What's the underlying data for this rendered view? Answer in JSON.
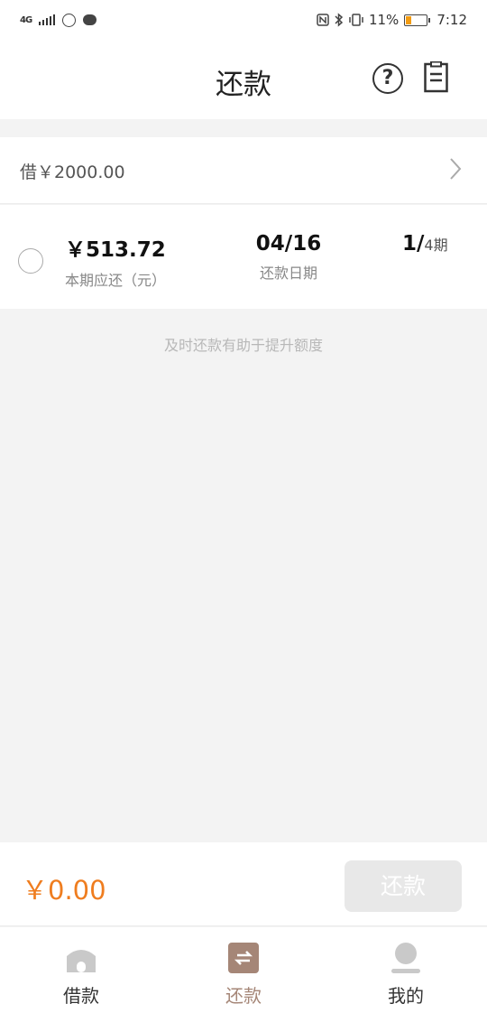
{
  "status_bar": {
    "network": "4G",
    "battery_percent": "11%",
    "time": "7:12",
    "icons": [
      "signal-icon",
      "app-icon",
      "chat-icon",
      "nfc-icon",
      "bluetooth-icon",
      "vibrate-icon",
      "battery-icon"
    ]
  },
  "header": {
    "title": "还款",
    "help_symbol": "?"
  },
  "loan": {
    "label": "借￥2000.00"
  },
  "installment": {
    "amount": "￥513.72",
    "amount_label": "本期应还（元）",
    "date": "04/16",
    "date_label": "还款日期",
    "period_current": "1/",
    "period_total": "4期"
  },
  "hint": "及时还款有助于提升额度",
  "pay_bar": {
    "total": "￥0.00",
    "button_label": "还款"
  },
  "tabs": [
    {
      "label": "借款",
      "icon": "home-icon",
      "active": false
    },
    {
      "label": "还款",
      "icon": "repay-icon",
      "active": true
    },
    {
      "label": "我的",
      "icon": "profile-icon",
      "active": false
    }
  ],
  "colors": {
    "accent_orange": "#ef7d1f",
    "active_tab": "#a58677",
    "disabled_button": "#e8e8e8"
  }
}
